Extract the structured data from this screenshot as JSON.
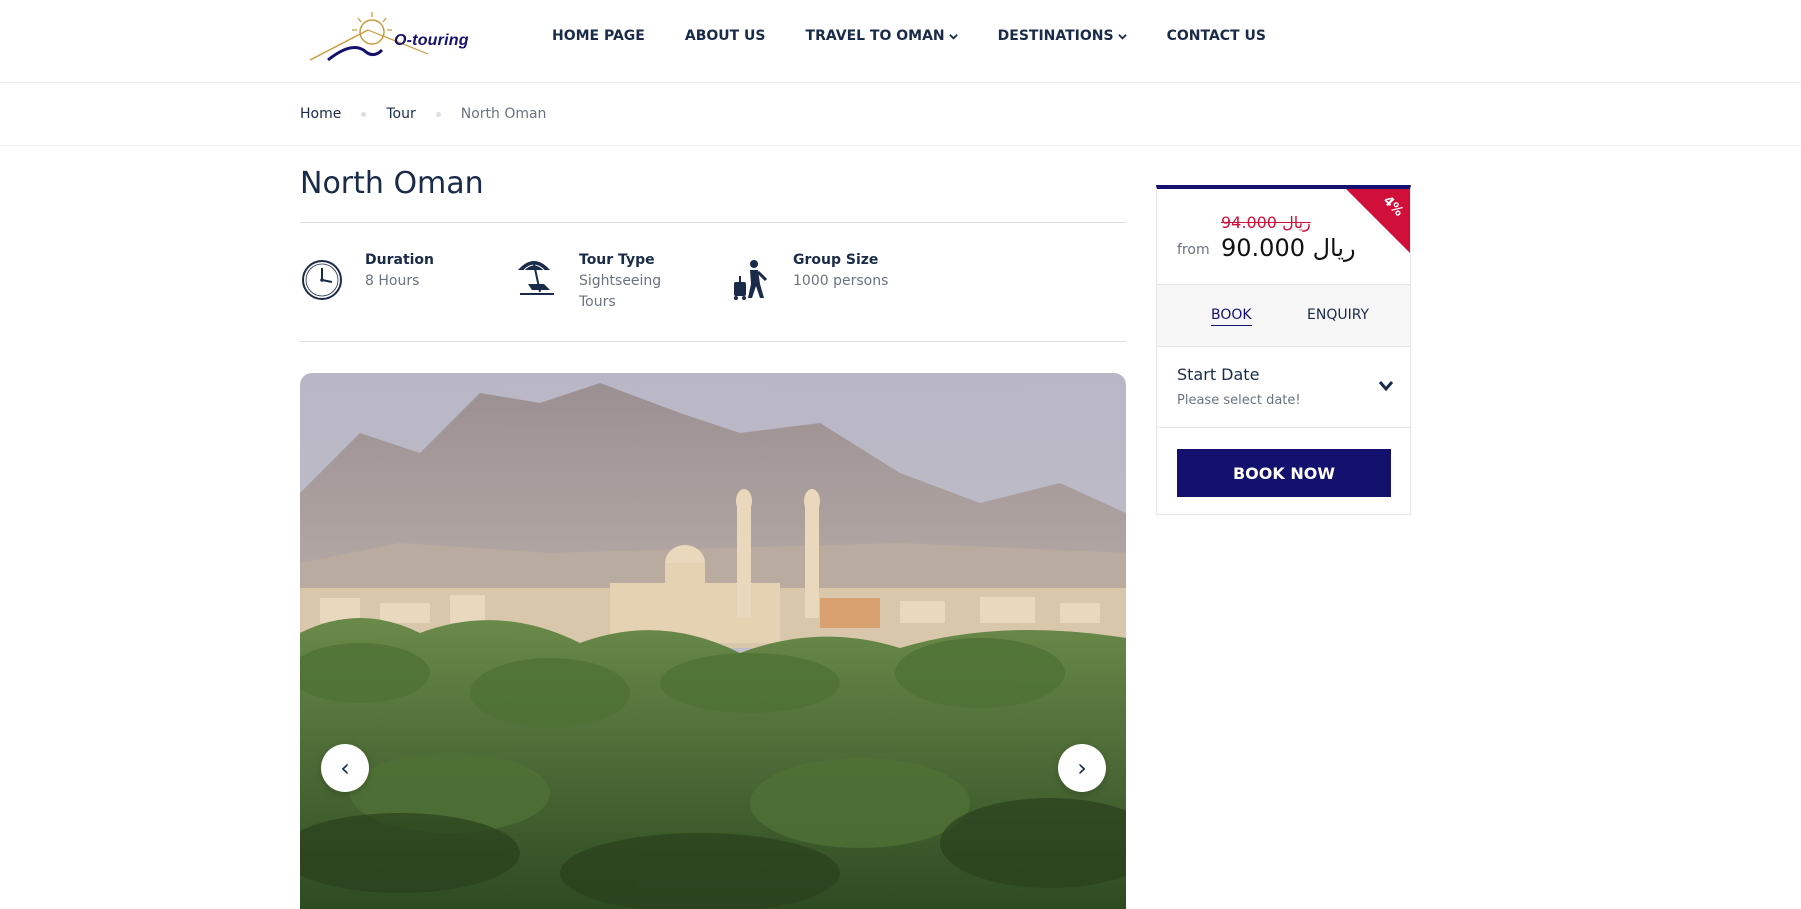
{
  "header": {
    "logo_text": "O-touring",
    "nav": [
      {
        "label": "HOME PAGE",
        "dropdown": false
      },
      {
        "label": "ABOUT US",
        "dropdown": false
      },
      {
        "label": "TRAVEL TO OMAN",
        "dropdown": true
      },
      {
        "label": "DESTINATIONS",
        "dropdown": true
      },
      {
        "label": "CONTACT US",
        "dropdown": false
      }
    ]
  },
  "breadcrumb": [
    "Home",
    "Tour",
    "North Oman"
  ],
  "page": {
    "title": "North Oman",
    "info": [
      {
        "icon": "clock-icon",
        "label": "Duration",
        "value": "8 Hours"
      },
      {
        "icon": "beach-umbrella-icon",
        "label": "Tour Type",
        "value": "Sightseeing Tours"
      },
      {
        "icon": "traveler-luggage-icon",
        "label": "Group Size",
        "value": "1000 persons"
      }
    ]
  },
  "gallery": {
    "prev": "‹",
    "next": "›"
  },
  "booking": {
    "discount": "4%",
    "old_price": "94.000 ريال",
    "from_label": "from",
    "price": "90.000 ريال",
    "tabs": [
      "BOOK",
      "ENQUIRY"
    ],
    "active_tab": "BOOK",
    "start_date_label": "Start Date",
    "start_date_placeholder": "Please select date!",
    "book_button": "BOOK NOW"
  },
  "colors": {
    "primary": "#14106e",
    "accent_red": "#d0103a",
    "text_dark": "#1a2b49",
    "text_muted": "#6b7380"
  }
}
